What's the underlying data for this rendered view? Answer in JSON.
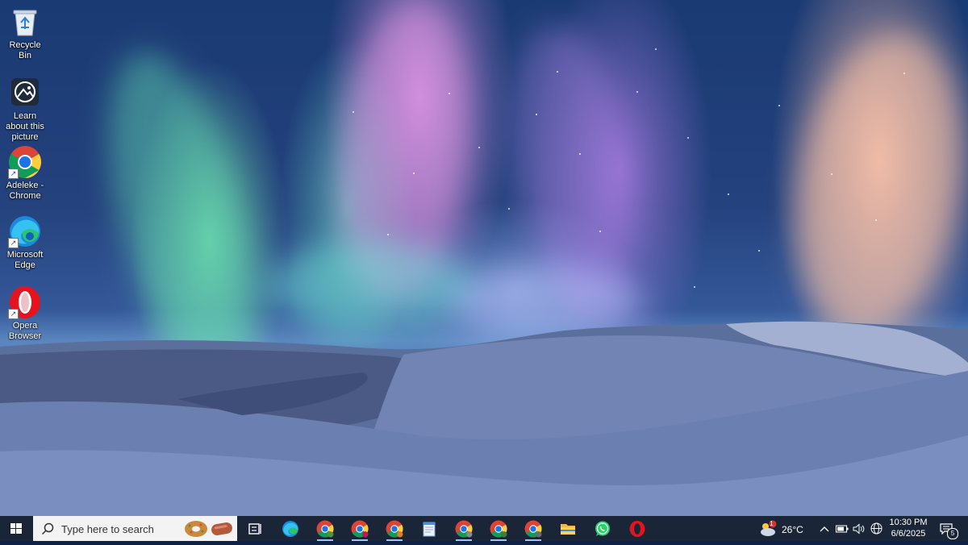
{
  "desktop": {
    "icons": [
      {
        "name": "recycle-bin",
        "label": "Recycle Bin"
      },
      {
        "name": "learn-about-picture",
        "label": "Learn about this picture"
      },
      {
        "name": "chrome-shortcut",
        "label": "Adeleke - Chrome"
      },
      {
        "name": "edge-shortcut",
        "label": "Microsoft Edge"
      },
      {
        "name": "opera-shortcut",
        "label": "Opera Browser"
      }
    ]
  },
  "taskbar": {
    "search_placeholder": "Type here to search",
    "apps": [
      {
        "name": "task-view"
      },
      {
        "name": "microsoft-edge"
      },
      {
        "name": "chrome-profile-1"
      },
      {
        "name": "chrome-profile-2"
      },
      {
        "name": "chrome-profile-3"
      },
      {
        "name": "notepad"
      },
      {
        "name": "chrome-profile-4"
      },
      {
        "name": "chrome-profile-5"
      },
      {
        "name": "chrome-profile-6"
      },
      {
        "name": "file-explorer"
      },
      {
        "name": "whatsapp"
      },
      {
        "name": "opera"
      }
    ],
    "tray": {
      "weather_temp": "26°C",
      "weather_badge": "1",
      "time": "10:30 PM",
      "date": "6/6/2025",
      "notification_count": "5"
    }
  },
  "colors": {
    "taskbar_bg": "#1b2538",
    "search_bg": "#f3f3f3",
    "accent": "#9ec5ff"
  }
}
